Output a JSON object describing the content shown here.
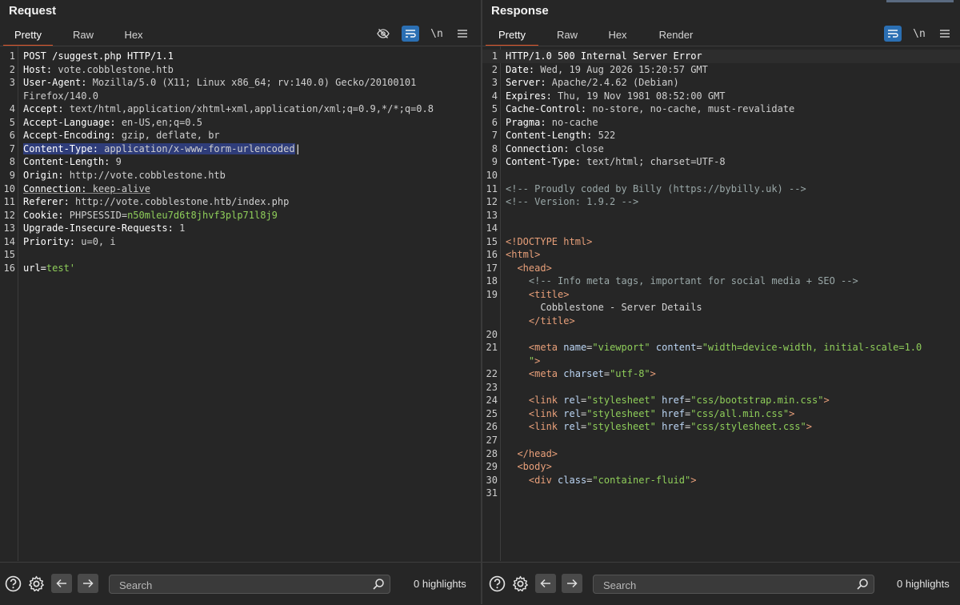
{
  "request": {
    "title": "Request",
    "tabs": [
      "Pretty",
      "Raw",
      "Hex"
    ],
    "active_tab": "Pretty",
    "toolbar_icons": [
      "eye-slash-icon",
      "wrap-icon",
      "newline-icon",
      "menu-icon"
    ],
    "newline_label": "\\n",
    "lines": [
      {
        "n": "1",
        "k": "POST /suggest.php HTTP/1.1",
        "v": ""
      },
      {
        "n": "2",
        "k": "Host:",
        "v": " vote.cobblestone.htb"
      },
      {
        "n": "3",
        "k": "User-Agent:",
        "v": " Mozilla/5.0 (X11; Linux x86_64; rv:140.0) Gecko/20100101"
      },
      {
        "n": "",
        "k": "",
        "v": "Firefox/140.0"
      },
      {
        "n": "4",
        "k": "Accept:",
        "v": " text/html,application/xhtml+xml,application/xml;q=0.9,*/*;q=0.8"
      },
      {
        "n": "5",
        "k": "Accept-Language:",
        "v": " en-US,en;q=0.5"
      },
      {
        "n": "6",
        "k": "Accept-Encoding:",
        "v": " gzip, deflate, br"
      },
      {
        "n": "7",
        "k": "Content-Type:",
        "v": " application/x-www-form-urlencoded"
      },
      {
        "n": "8",
        "k": "Content-Length:",
        "v": " 9"
      },
      {
        "n": "9",
        "k": "Origin:",
        "v": " http://vote.cobblestone.htb"
      },
      {
        "n": "10",
        "k": "Connection:",
        "v": " keep-alive"
      },
      {
        "n": "11",
        "k": "Referer:",
        "v": " http://vote.cobblestone.htb/index.php"
      },
      {
        "n": "12",
        "k": "Cookie:",
        "v": " PHPSESSID=",
        "g": "n50mleu7d6t8jhvf3plp71l8j9"
      },
      {
        "n": "13",
        "k": "Upgrade-Insecure-Requests:",
        "v": " 1"
      },
      {
        "n": "14",
        "k": "Priority:",
        "v": " u=0, i"
      },
      {
        "n": "15",
        "k": "",
        "v": ""
      },
      {
        "n": "16",
        "k": "url=",
        "v": "",
        "g": "test'"
      }
    ],
    "search_placeholder": "Search",
    "highlights": "0 highlights"
  },
  "response": {
    "title": "Response",
    "tabs": [
      "Pretty",
      "Raw",
      "Hex",
      "Render"
    ],
    "active_tab": "Pretty",
    "toolbar_icons": [
      "wrap-icon",
      "newline-icon",
      "menu-icon"
    ],
    "newline_label": "\\n",
    "headers": [
      {
        "n": "1",
        "k": "HTTP/1.0 500 Internal Server Error",
        "v": ""
      },
      {
        "n": "2",
        "k": "Date:",
        "v": " Wed, 19 Aug 2026 15:20:57 GMT"
      },
      {
        "n": "3",
        "k": "Server:",
        "v": " Apache/2.4.62 (Debian)"
      },
      {
        "n": "4",
        "k": "Expires:",
        "v": " Thu, 19 Nov 1981 08:52:00 GMT"
      },
      {
        "n": "5",
        "k": "Cache-Control:",
        "v": " no-store, no-cache, must-revalidate"
      },
      {
        "n": "6",
        "k": "Pragma:",
        "v": " no-cache"
      },
      {
        "n": "7",
        "k": "Content-Length:",
        "v": " 522"
      },
      {
        "n": "8",
        "k": "Connection:",
        "v": " close"
      },
      {
        "n": "9",
        "k": "Content-Type:",
        "v": " text/html; charset=UTF-8"
      }
    ],
    "body_lines": [
      {
        "n": "10",
        "html": ""
      },
      {
        "n": "11",
        "html": "<span class=\"c\">&lt;!-- Proudly coded by Billy (https://bybilly.uk) --&gt;</span>"
      },
      {
        "n": "12",
        "html": "<span class=\"c\">&lt;!-- Version: 1.9.2 --&gt;</span>"
      },
      {
        "n": "13",
        "html": ""
      },
      {
        "n": "14",
        "html": ""
      },
      {
        "n": "15",
        "html": "<span class=\"t\">&lt;!DOCTYPE html&gt;</span>"
      },
      {
        "n": "16",
        "html": "<span class=\"t\">&lt;html&gt;</span>"
      },
      {
        "n": "17",
        "html": "  <span class=\"t\">&lt;head&gt;</span>"
      },
      {
        "n": "18",
        "html": "    <span class=\"c\">&lt;!-- Info meta tags, important for social media + SEO --&gt;</span>"
      },
      {
        "n": "19",
        "html": "    <span class=\"t\">&lt;title&gt;</span>"
      },
      {
        "n": "",
        "html": "      Cobblestone - Server Details"
      },
      {
        "n": "",
        "html": "    <span class=\"t\">&lt;/title&gt;</span>"
      },
      {
        "n": "20",
        "html": ""
      },
      {
        "n": "21",
        "html": "    <span class=\"t\">&lt;meta</span> <span class=\"a\">name</span>=<span class=\"s\">\"viewport\"</span> <span class=\"a\">content</span>=<span class=\"s\">\"width=device-width, initial-scale=1.0</span>"
      },
      {
        "n": "",
        "html": "    <span class=\"s\">\"</span><span class=\"t\">&gt;</span>"
      },
      {
        "n": "22",
        "html": "    <span class=\"t\">&lt;meta</span> <span class=\"a\">charset</span>=<span class=\"s\">\"utf-8\"</span><span class=\"t\">&gt;</span>"
      },
      {
        "n": "23",
        "html": ""
      },
      {
        "n": "24",
        "html": "    <span class=\"t\">&lt;link</span> <span class=\"a\">rel</span>=<span class=\"s\">\"stylesheet\"</span> <span class=\"a\">href</span>=<span class=\"s\">\"css/bootstrap.min.css\"</span><span class=\"t\">&gt;</span>"
      },
      {
        "n": "25",
        "html": "    <span class=\"t\">&lt;link</span> <span class=\"a\">rel</span>=<span class=\"s\">\"stylesheet\"</span> <span class=\"a\">href</span>=<span class=\"s\">\"css/all.min.css\"</span><span class=\"t\">&gt;</span>"
      },
      {
        "n": "26",
        "html": "    <span class=\"t\">&lt;link</span> <span class=\"a\">rel</span>=<span class=\"s\">\"stylesheet\"</span> <span class=\"a\">href</span>=<span class=\"s\">\"css/stylesheet.css\"</span><span class=\"t\">&gt;</span>"
      },
      {
        "n": "27",
        "html": ""
      },
      {
        "n": "28",
        "html": "  <span class=\"t\">&lt;/head&gt;</span>"
      },
      {
        "n": "29",
        "html": "  <span class=\"t\">&lt;body&gt;</span>"
      },
      {
        "n": "30",
        "html": "    <span class=\"t\">&lt;div</span> <span class=\"a\">class</span>=<span class=\"s\">\"container-fluid\"</span><span class=\"t\">&gt;</span>"
      },
      {
        "n": "31",
        "html": ""
      }
    ],
    "search_placeholder": "Search",
    "highlights": "0 highlights"
  },
  "colors": {
    "accent_tab": "#e2572b",
    "wrap_button": "#2b6fb3",
    "selection": "#2f3d7a"
  }
}
